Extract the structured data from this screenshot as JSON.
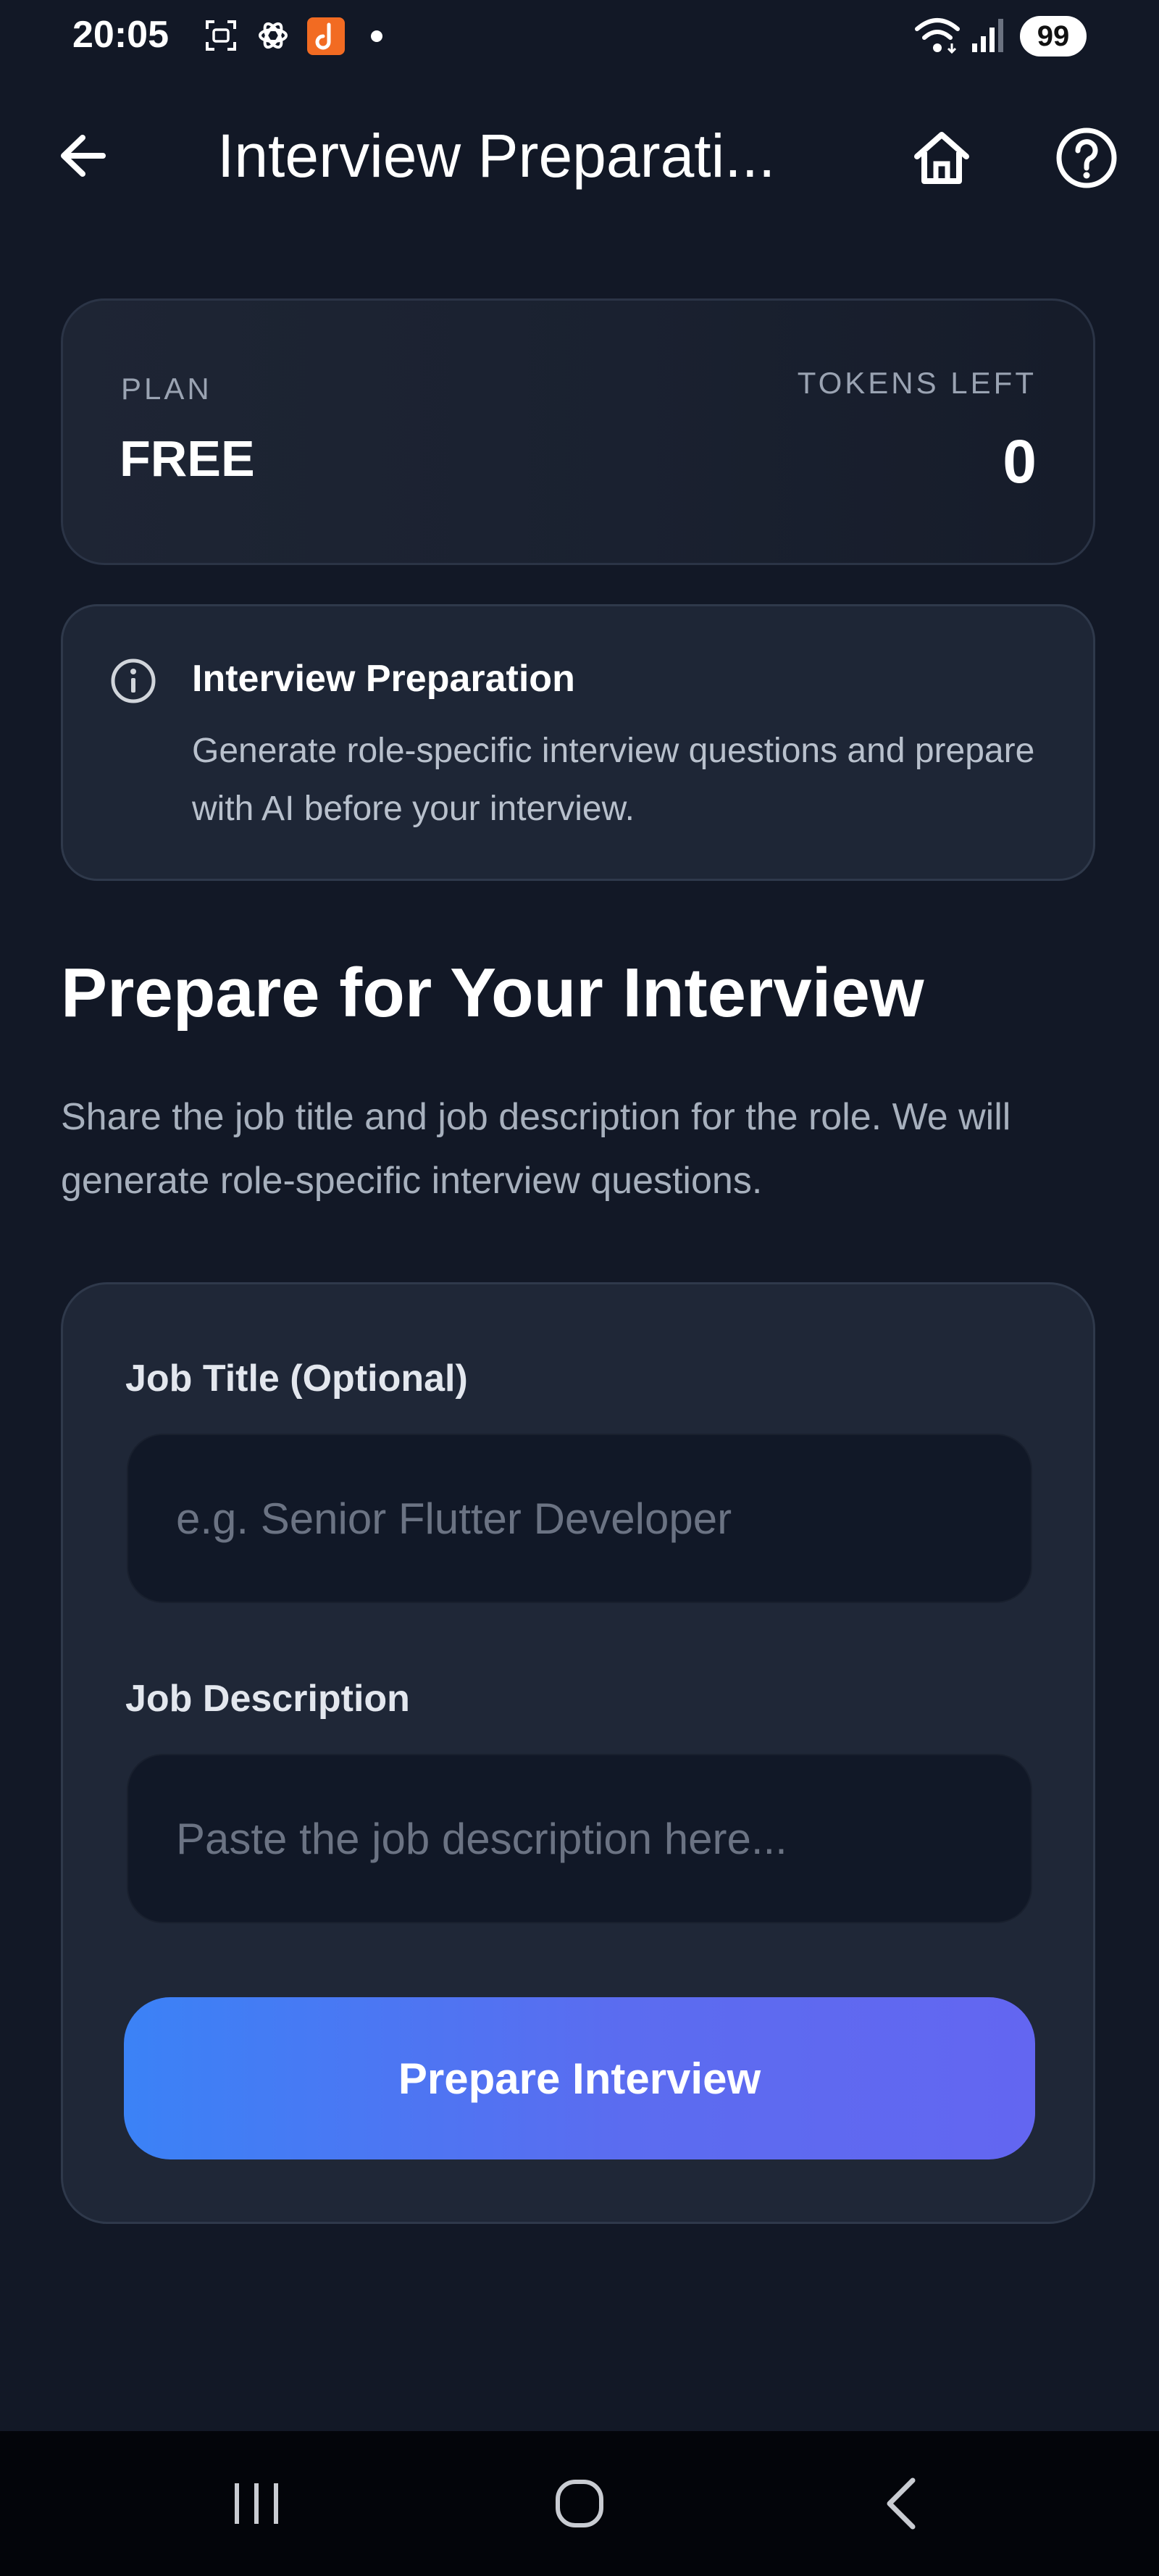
{
  "status_bar": {
    "time": "20:05",
    "battery": "99",
    "icons": [
      "screenshot-icon",
      "openai-icon",
      "app-notification-icon",
      "dot-icon",
      "wifi-icon",
      "signal-icon"
    ]
  },
  "app_bar": {
    "title": "Interview Preparati...",
    "icons": [
      "back-arrow-icon",
      "home-icon",
      "help-icon"
    ]
  },
  "plan": {
    "label": "PLAN",
    "value": "FREE",
    "tokens_label": "TOKENS LEFT",
    "tokens_value": "0"
  },
  "info": {
    "title": "Interview Preparation",
    "text": "Generate role-specific interview questions and prepare with AI before your interview."
  },
  "section": {
    "heading": "Prepare for Your Interview",
    "subtitle": "Share the job title and job description for the role. We will generate role-specific interview questions."
  },
  "form": {
    "job_title_label": "Job Title (Optional)",
    "job_title_placeholder": "e.g. Senior Flutter Developer",
    "job_title_value": "",
    "job_description_label": "Job Description",
    "job_description_placeholder": "Paste the job description here...",
    "job_description_value": "",
    "submit_label": "Prepare Interview"
  },
  "colors": {
    "background": "#121826",
    "card": "#1f2737",
    "input": "#111827",
    "accent_start": "#3b82f6",
    "accent_end": "#6366f1"
  }
}
